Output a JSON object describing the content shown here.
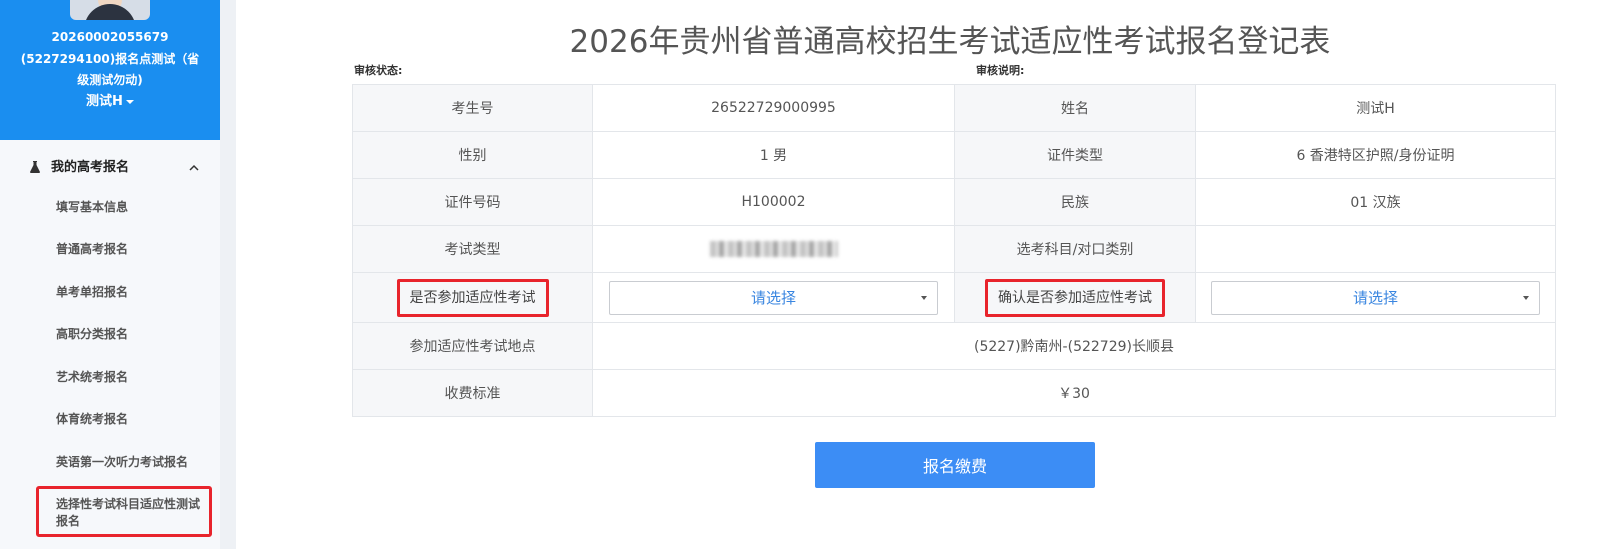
{
  "sidebar": {
    "profile": {
      "id": "20260002055679",
      "org_line1": "(5227294100)报名点测试（省",
      "org_line2": "级测试勿动)",
      "user": "测试H"
    },
    "menu_title": "我的高考报名",
    "items": [
      {
        "label": "填写基本信息"
      },
      {
        "label": "普通高考报名"
      },
      {
        "label": "单考单招报名"
      },
      {
        "label": "高职分类报名"
      },
      {
        "label": "艺术统考报名"
      },
      {
        "label": "体育统考报名"
      },
      {
        "label": "英语第一次听力考试报名"
      },
      {
        "label": "选择性考试科目适应性测试报名"
      }
    ]
  },
  "main": {
    "title": "2026年贵州省普通高校招生考试适应性考试报名登记表",
    "review_status_label": "审核状态:",
    "review_note_label": "审核说明:",
    "form": {
      "exam_no_label": "考生号",
      "exam_no": "26522729000995",
      "name_label": "姓名",
      "name": "测试H",
      "gender_label": "性别",
      "gender": "1 男",
      "id_type_label": "证件类型",
      "id_type": "6 香港特区护照/身份证明",
      "id_no_label": "证件号码",
      "id_no": "H100002",
      "ethnic_label": "民族",
      "ethnic": "01 汉族",
      "exam_type_label": "考试类型",
      "subject_label": "选考科目/对口类别",
      "join_label": "是否参加适应性考试",
      "join_select": "请选择",
      "confirm_label": "确认是否参加适应性考试",
      "confirm_select": "请选择",
      "location_label": "参加适应性考试地点",
      "location": "(5227)黔南州-(522729)长顺县",
      "fee_label": "收费标准",
      "fee": "￥30"
    },
    "pay_button": "报名缴费"
  },
  "colors": {
    "sidebar_header": "#1a8ef0",
    "highlight": "#e8242c",
    "button": "#3c8df5",
    "select_text": "#3a86e0"
  }
}
